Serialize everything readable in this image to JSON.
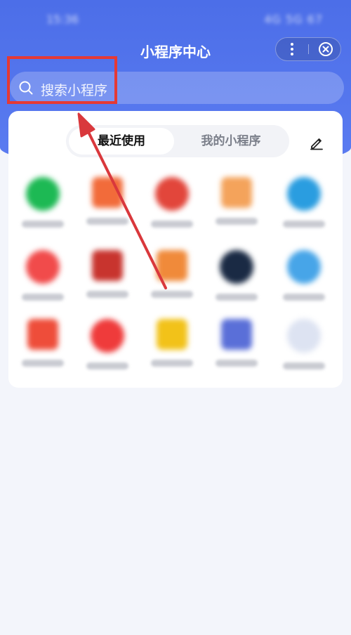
{
  "header": {
    "title": "小程序中心",
    "status_time": "15:36",
    "status_right": "4G 5G 67"
  },
  "search": {
    "placeholder": "搜索小程序"
  },
  "tabs": {
    "recent": "最近使用",
    "mine": "我的小程序"
  },
  "colors": {
    "header": "#4c6ee8",
    "highlight": "#e53935",
    "arrow": "#d9383c"
  },
  "apps": [
    {
      "color": "#1db954",
      "shape": "circle"
    },
    {
      "color": "#f26b3a",
      "shape": "square"
    },
    {
      "color": "#e2463b",
      "shape": "circle"
    },
    {
      "color": "#f4a35b",
      "shape": "square"
    },
    {
      "color": "#2a9de0",
      "shape": "circle"
    },
    {
      "color": "#f14b4b",
      "shape": "circle"
    },
    {
      "color": "#c8342e",
      "shape": "square"
    },
    {
      "color": "#f08a3a",
      "shape": "square"
    },
    {
      "color": "#1a2a44",
      "shape": "circle"
    },
    {
      "color": "#47a5e8",
      "shape": "circle"
    },
    {
      "color": "#ee4d3a",
      "shape": "square"
    },
    {
      "color": "#ef3b3b",
      "shape": "circle"
    },
    {
      "color": "#f2c219",
      "shape": "square"
    },
    {
      "color": "#5a6fd8",
      "shape": "square"
    },
    {
      "color": "#dde3f2",
      "shape": "circle"
    }
  ]
}
